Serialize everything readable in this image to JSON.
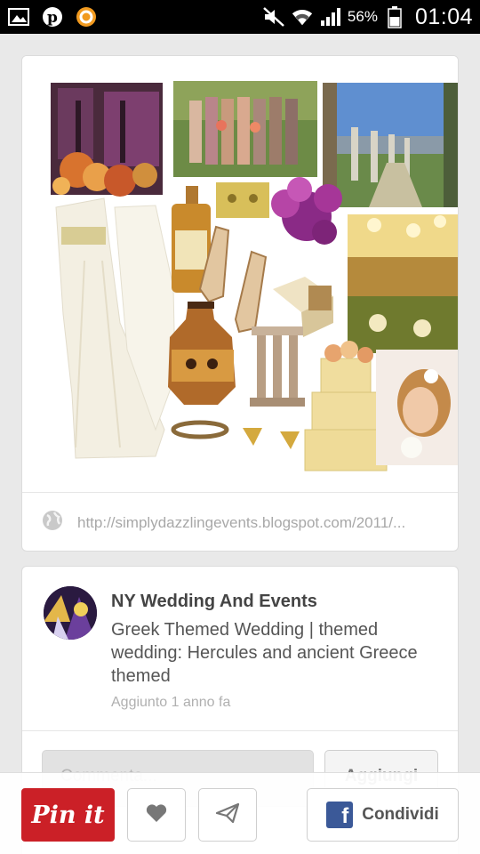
{
  "status_bar": {
    "battery_percent": "56%",
    "time": "01:04",
    "icons": [
      "gallery-icon",
      "pinterest-icon",
      "orange-app-icon",
      "mute-icon",
      "wifi-icon",
      "signal-icon",
      "battery-icon"
    ]
  },
  "pin": {
    "image_alt": "Greek themed wedding mood board collage",
    "source_url": "http://simplydazzlingevents.blogspot.com/2011/...",
    "board_name": "NY Wedding And Events",
    "description": "Greek Themed Wedding | themed wedding: Hercules and ancient Greece themed",
    "added_time": "Aggiunto 1 anno fa",
    "comment_placeholder": "Commenta...",
    "add_label": "Aggiungi"
  },
  "actions": {
    "pinit_label": "Pin it",
    "share_label": "Condividi",
    "facebook_letter": "f"
  },
  "colors": {
    "pinterest_red": "#cb2027",
    "facebook_blue": "#3b5998"
  }
}
